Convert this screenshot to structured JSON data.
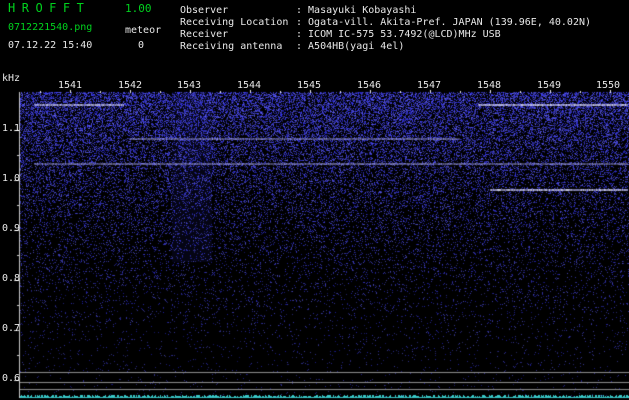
{
  "app": {
    "name": "HROFFT",
    "version": "1.00",
    "filename": "0712221540.png",
    "datetime": "07.12.22 15:40",
    "meteor_label": "meteor",
    "meteor_count": "0"
  },
  "info": {
    "observer_label": "Observer",
    "observer_value": ": Masayuki Kobayashi",
    "location_label": "Receiving Location",
    "location_value": ": Ogata-vill. Akita-Pref. JAPAN (139.96E, 40.02N)",
    "receiver_label": "Receiver",
    "receiver_value": ": ICOM IC-575 53.7492(@LCD)MHz USB",
    "antenna_label": "Receiving antenna",
    "antenna_value": ": A504HB(yagi 4el)"
  },
  "colors": {
    "background": "#000000",
    "text_green": "#00d21e",
    "text_white": "#e8e8e8",
    "noise_blue": "#3c3cff",
    "ref_lines": "#8c8c8c"
  },
  "chart_data": {
    "type": "heatmap",
    "ylabel": "kHz",
    "x_ticks": [
      "1541",
      "1542",
      "1543",
      "1544",
      "1545",
      "1546",
      "1547",
      "1548",
      "1549",
      "1550"
    ],
    "y_ticks": [
      "1.1",
      "1.0",
      "0.9",
      "0.8",
      "0.7",
      "0.6"
    ],
    "ylim": [
      0.57,
      1.17
    ],
    "signals": [
      {
        "freq": 1.151,
        "x_start": 1540.4,
        "x_end": 1541.9,
        "strength": 0.8
      },
      {
        "freq": 1.151,
        "x_start": 1547.8,
        "x_end": 1550.3,
        "strength": 0.85
      },
      {
        "freq": 1.085,
        "x_start": 1542.0,
        "x_end": 1547.5,
        "strength": 0.55
      },
      {
        "freq": 1.035,
        "x_start": 1540.4,
        "x_end": 1550.3,
        "strength": 0.55
      },
      {
        "freq": 0.983,
        "x_start": 1548.0,
        "x_end": 1550.3,
        "strength": 0.85
      }
    ],
    "reference_lines_khz": [
      0.616,
      0.597,
      0.583
    ]
  }
}
